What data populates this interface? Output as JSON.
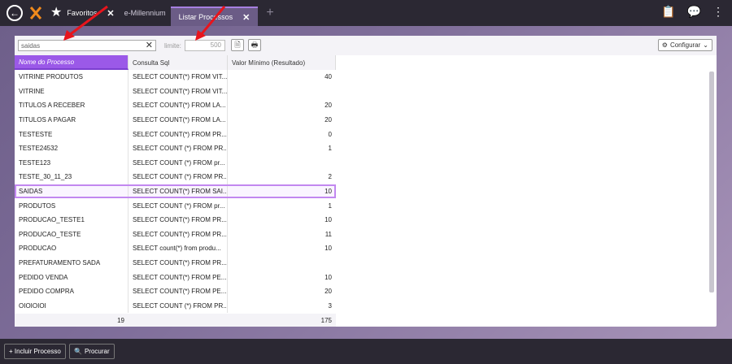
{
  "topbar": {
    "back_icon": "back-arrow-icon",
    "favorites_label": "Favoritos",
    "tabs": [
      {
        "label": "e-Millennium",
        "active": false
      },
      {
        "label": "Listar Processos",
        "active": true
      }
    ],
    "add_tab_symbol": "+"
  },
  "toolbar": {
    "search_value": "saidas",
    "limit_label": "limite:",
    "limit_value": "500",
    "config_label": "Configurar"
  },
  "grid": {
    "columns": [
      "Nome do Processo",
      "Consulta Sql",
      "Valor Mínimo (Resultado)"
    ],
    "rows": [
      {
        "name": "VITRINE PRODUTOS",
        "sql": "SELECT COUNT(*) FROM VIT...",
        "value": "40"
      },
      {
        "name": "VITRINE",
        "sql": "SELECT COUNT(*) FROM VIT...",
        "value": ""
      },
      {
        "name": "TITULOS A RECEBER",
        "sql": "SELECT COUNT(*) FROM LA...",
        "value": "20"
      },
      {
        "name": "TITULOS A PAGAR",
        "sql": "SELECT COUNT(*) FROM LA...",
        "value": "20"
      },
      {
        "name": "TESTESTE",
        "sql": "SELECT COUNT(*) FROM PR...",
        "value": "0"
      },
      {
        "name": "TESTE24532",
        "sql": "SELECT COUNT (*) FROM PR...",
        "value": "1"
      },
      {
        "name": "TESTE123",
        "sql": "SELECT COUNT (*) FROM pr...",
        "value": ""
      },
      {
        "name": "TESTE_30_11_23",
        "sql": "SELECT COUNT (*) FROM PR...",
        "value": "2"
      },
      {
        "name": "SAIDAS",
        "sql": "SELECT COUNT(*) FROM SAI...",
        "value": "10"
      },
      {
        "name": "PRODUTOS",
        "sql": "SELECT COUNT (*) FROM pr...",
        "value": "1"
      },
      {
        "name": "PRODUCAO_TESTE1",
        "sql": "SELECT COUNT(*) FROM PR...",
        "value": "10"
      },
      {
        "name": "PRODUCAO_TESTE",
        "sql": "SELECT COUNT(*) FROM PR...",
        "value": "11"
      },
      {
        "name": "PRODUCAO",
        "sql": "SELECT count(*) from produ...",
        "value": "10"
      },
      {
        "name": "PREFATURAMENTO SADA",
        "sql": "SELECT COUNT(*) FROM PR...",
        "value": ""
      },
      {
        "name": "PEDIDO VENDA",
        "sql": "SELECT COUNT(*) FROM PE...",
        "value": "10"
      },
      {
        "name": "PEDIDO COMPRA",
        "sql": "SELECT COUNT(*) FROM PE...",
        "value": "20"
      },
      {
        "name": "OIOIOIOI",
        "sql": "SELECT COUNT (*) FROM PR...",
        "value": "3"
      }
    ],
    "selected_row_index": 8,
    "footer": {
      "count": "19",
      "sum": "175"
    }
  },
  "bottombar": {
    "add_button_label": "+ Incluir Processo",
    "search_button_label": "Procurar"
  },
  "colors": {
    "accent": "#9b59e8",
    "selection_outline": "#c288f0",
    "annotation_arrow": "#e8141c"
  }
}
